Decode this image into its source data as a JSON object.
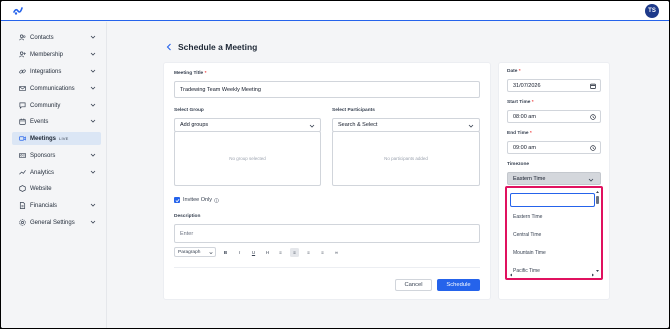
{
  "header": {
    "avatar_initials": "TS"
  },
  "sidebar": {
    "items": [
      {
        "label": "Contacts",
        "icon": "users-icon"
      },
      {
        "label": "Membership",
        "icon": "user-plus-icon"
      },
      {
        "label": "Integrations",
        "icon": "link-icon"
      },
      {
        "label": "Communications",
        "icon": "mail-icon"
      },
      {
        "label": "Community",
        "icon": "chat-icon"
      },
      {
        "label": "Events",
        "icon": "calendar-icon"
      },
      {
        "label": "Meetings",
        "icon": "video-icon",
        "badge": "LIVE",
        "active": true
      },
      {
        "label": "Sponsors",
        "icon": "id-card-icon"
      },
      {
        "label": "Analytics",
        "icon": "analytics-icon"
      },
      {
        "label": "Website",
        "icon": "globe-icon"
      },
      {
        "label": "Financials",
        "icon": "document-icon"
      },
      {
        "label": "General Settings",
        "icon": "gear-icon"
      }
    ]
  },
  "page": {
    "title": "Schedule a Meeting"
  },
  "form": {
    "meeting_title_label": "Meeting Title",
    "required_mark": "*",
    "meeting_title_value": "Tradewing Team Weekly Meeting",
    "select_group_label": "Select Group",
    "select_group_placeholder": "Add groups",
    "no_group_text": "No group selected",
    "select_participants_label": "Select Participants",
    "participants_placeholder": "Search & Select",
    "no_participants_text": "No participants added",
    "invitee_only_label": "Invitee Only",
    "description_label": "Description",
    "description_placeholder": "Enter",
    "toolbar": {
      "paragraph": "Paragraph",
      "bold": "B",
      "italic": "I",
      "underline": "U",
      "heading": "H",
      "list": "≡",
      "align_left": "≡",
      "align_center": "≡",
      "align_right": "≡",
      "link": "∞"
    },
    "cancel_label": "Cancel",
    "schedule_label": "Schedule"
  },
  "side_form": {
    "date_label": "Date",
    "date_value": "31/07/2026",
    "start_time_label": "Start Time",
    "start_time_value": "08:00 am",
    "end_time_label": "End Time",
    "end_time_value": "09:00 am",
    "timezone_label": "Timezone",
    "timezone_value": "Eastern Time",
    "timezone_options": [
      "Eastern Time",
      "Central Time",
      "Mountain Time",
      "Pacific Time"
    ]
  },
  "colors": {
    "primary": "#2563eb",
    "avatar_bg": "#1e3a8a",
    "highlight_border": "#e0115f",
    "active_nav_bg": "#dbe6f5",
    "timezone_select_bg": "#d4d7dc"
  }
}
